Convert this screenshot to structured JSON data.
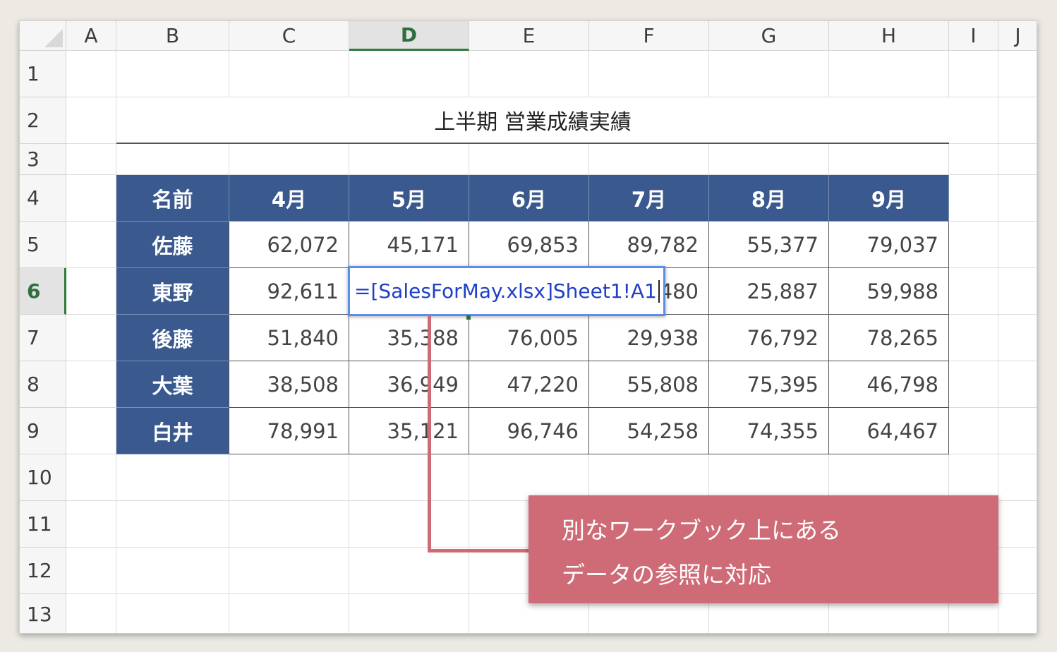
{
  "columns": [
    "A",
    "B",
    "C",
    "D",
    "E",
    "F",
    "G",
    "H",
    "I",
    "J"
  ],
  "rows": [
    "1",
    "2",
    "3",
    "4",
    "5",
    "6",
    "7",
    "8",
    "9",
    "10",
    "11",
    "12",
    "13"
  ],
  "selected_column": "D",
  "selected_row": "6",
  "title": "上半期 営業成績実績",
  "table": {
    "headers": [
      "名前",
      "4月",
      "5月",
      "6月",
      "7月",
      "8月",
      "9月"
    ],
    "names": [
      "佐藤",
      "東野",
      "後藤",
      "大葉",
      "白井"
    ],
    "values": [
      [
        "62,072",
        "45,171",
        "69,853",
        "89,782",
        "55,377",
        "79,037"
      ],
      [
        "92,611",
        "",
        "",
        "480",
        "25,887",
        "59,988"
      ],
      [
        "51,840",
        "35,388",
        "76,005",
        "29,938",
        "76,792",
        "78,265"
      ],
      [
        "38,508",
        "36,949",
        "47,220",
        "55,808",
        "75,395",
        "46,798"
      ],
      [
        "78,991",
        "35,121",
        "96,746",
        "54,258",
        "74,355",
        "64,467"
      ]
    ]
  },
  "formula_editor": {
    "text": "=[SalesForMay.xlsx]Sheet1!A1"
  },
  "callout": {
    "line1": "別なワークブック上にある",
    "line2": "データの参照に対応",
    "color": "#cf6b76"
  },
  "colors": {
    "header_fill": "#3a5a8f",
    "selection_green": "#2f7a3a",
    "formula_blue": "#1f3fc7"
  }
}
